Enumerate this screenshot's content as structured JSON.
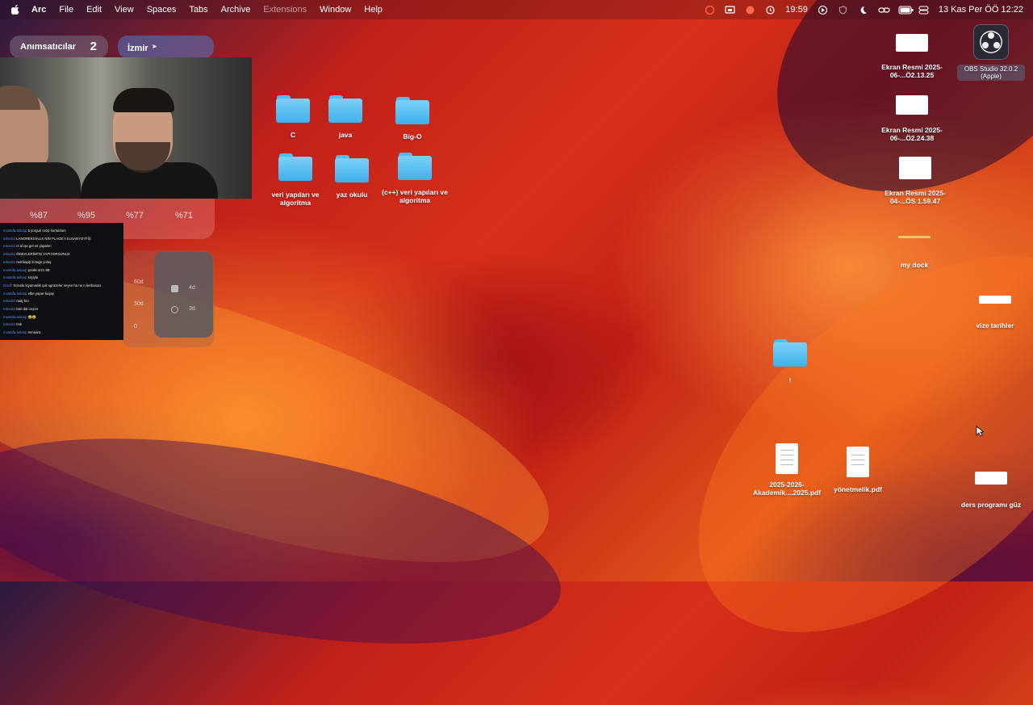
{
  "menubar": {
    "app_name": "Arc",
    "menus": [
      "File",
      "Edit",
      "View",
      "Spaces",
      "Tabs",
      "Archive",
      "Extensions",
      "Window",
      "Help"
    ],
    "clock": "19:59",
    "date": "13 Kas Per ÖÖ 12:22"
  },
  "widgets": {
    "reminders": {
      "label": "Anımsatıcılar",
      "count": "2"
    },
    "weather": {
      "city": "İzmir"
    },
    "battery_percents": [
      "%87",
      "%95",
      "%77",
      "%71"
    ],
    "screen_time": {
      "ticks": [
        "60d",
        "30d",
        "0"
      ],
      "items": [
        {
          "value": "4d"
        },
        {
          "value": "3d"
        }
      ]
    }
  },
  "chat_lines": [
    {
      "user": "mustafa.ankaq",
      "text": "5 yorgun cezp kurtuldum"
    },
    {
      "user": "eskedo",
      "text": "LANOREKSİALIX NİN PLAGE'A ELNABYOYFİZ"
    },
    {
      "user": "eskedo",
      "text": "o' al işe gel ve yapalım"
    },
    {
      "user": "eskedo",
      "text": "ÖDEVLERİMİ'Nİ YAPIYORSUNUZ"
    },
    {
      "user": "eskedo",
      "text": "nemliayip ki tags yolaş"
    },
    {
      "user": "mustafa.ankaq",
      "text": "pzolki 4/21 8B"
    },
    {
      "user": "mustafa.ankaq",
      "text": "kırpyle"
    },
    {
      "user": "Ozelf",
      "text": "Sorudu kiyamadık çok sgrazeler neyse ha ne n kerbanan"
    },
    {
      "user": "mustafa.ankaq",
      "text": "elbe yapar kuşay"
    },
    {
      "user": "eskedo",
      "text": "naaj bro"
    },
    {
      "user": "eskedo",
      "text": "bari dal ceyon"
    },
    {
      "user": "mustafa.ankaq",
      "text": "😂😂"
    },
    {
      "user": "eskedo",
      "text": "tmk"
    },
    {
      "user": "mustafa.ankaq",
      "text": "mmaara"
    }
  ],
  "desktop": {
    "folders": [
      {
        "label": "C"
      },
      {
        "label": "java"
      },
      {
        "label": "Big-O"
      },
      {
        "label": "veri yapıları ve algoritma"
      },
      {
        "label": "yaz okulu"
      },
      {
        "label": "(c++) veri yapıları ve algoritma"
      },
      {
        "label": "!"
      }
    ],
    "files": [
      {
        "label": "Ekran Resmi 2025-06-...Ö2.13.25"
      },
      {
        "label": "Ekran Resmi 2025-06-...Ö2.24.38"
      },
      {
        "label": "Ekran Resmi 2025-04-...ÖS 1.59.47"
      },
      {
        "label": "my dock"
      },
      {
        "label": "vize tarihler"
      },
      {
        "label": "2025-2026-Akademik....2025.pdf"
      },
      {
        "label": "yönetmelik.pdf"
      },
      {
        "label": "ders programı güz"
      },
      {
        "label": "OBS Studio 32.0.2 (Apple)"
      }
    ]
  },
  "colors": {
    "accent_folder": "#3fb0ec",
    "chat_user": "#5b8df0"
  }
}
